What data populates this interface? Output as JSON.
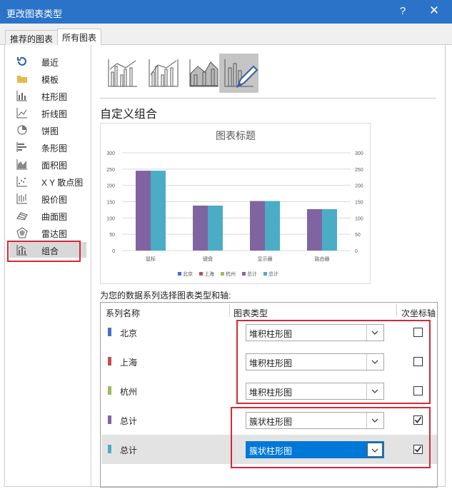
{
  "window": {
    "title": "更改图表类型",
    "help": "?",
    "close": "✕"
  },
  "tabs": [
    {
      "label": "推荐的图表"
    },
    {
      "label": "所有图表"
    }
  ],
  "sidebar": {
    "items": [
      {
        "label": "最近",
        "icon": "recent-icon"
      },
      {
        "label": "模板",
        "icon": "folder-icon"
      },
      {
        "label": "柱形图",
        "icon": "column-chart-icon"
      },
      {
        "label": "折线图",
        "icon": "line-chart-icon"
      },
      {
        "label": "饼图",
        "icon": "pie-chart-icon"
      },
      {
        "label": "条形图",
        "icon": "bar-chart-icon"
      },
      {
        "label": "面积图",
        "icon": "area-chart-icon"
      },
      {
        "label": "X Y 散点图",
        "icon": "scatter-chart-icon"
      },
      {
        "label": "股价图",
        "icon": "stock-chart-icon"
      },
      {
        "label": "曲面图",
        "icon": "surface-chart-icon"
      },
      {
        "label": "雷达图",
        "icon": "radar-chart-icon"
      },
      {
        "label": "组合",
        "icon": "combo-chart-icon",
        "selected": true
      }
    ]
  },
  "section_title": "自定义组合",
  "chart_data": {
    "type": "bar",
    "title": "图表标题",
    "categories": [
      "鼠标",
      "键盘",
      "显示器",
      "路由器"
    ],
    "series": [
      {
        "name": "北京",
        "values": [
          0,
          0,
          0,
          0
        ]
      },
      {
        "name": "上海",
        "values": [
          0,
          0,
          0,
          0
        ]
      },
      {
        "name": "杭州",
        "values": [
          0,
          0,
          0,
          0
        ]
      },
      {
        "name": "总计",
        "values": [
          245,
          138,
          152,
          127
        ]
      },
      {
        "name": "总计",
        "values": [
          245,
          138,
          152,
          127
        ]
      }
    ],
    "ylim": [
      0,
      300
    ],
    "yticks": [
      0,
      50,
      100,
      150,
      200,
      250,
      300
    ],
    "secondary_yticks": [
      0,
      50,
      100,
      150,
      200,
      250,
      300
    ],
    "colors": [
      "#4472c4",
      "#c0504d",
      "#9bbb59",
      "#8064a2",
      "#4bacc6"
    ],
    "legend_position": "bottom",
    "grid": true
  },
  "prompt_text": "为您的数据系列选择图表类型和轴:",
  "table": {
    "headers": [
      "系列名称",
      "图表类型",
      "次坐标轴"
    ],
    "rows": [
      {
        "name": "北京",
        "color": "#4472c4",
        "type": "堆积柱形图",
        "secondary": false
      },
      {
        "name": "上海",
        "color": "#c0504d",
        "type": "堆积柱形图",
        "secondary": false
      },
      {
        "name": "杭州",
        "color": "#9bbb59",
        "type": "堆积柱形图",
        "secondary": false
      },
      {
        "name": "总计",
        "color": "#8064a2",
        "type": "簇状柱形图",
        "secondary": true
      },
      {
        "name": "总计",
        "color": "#4bacc6",
        "type": "簇状柱形图",
        "secondary": true,
        "selected": true
      }
    ]
  }
}
